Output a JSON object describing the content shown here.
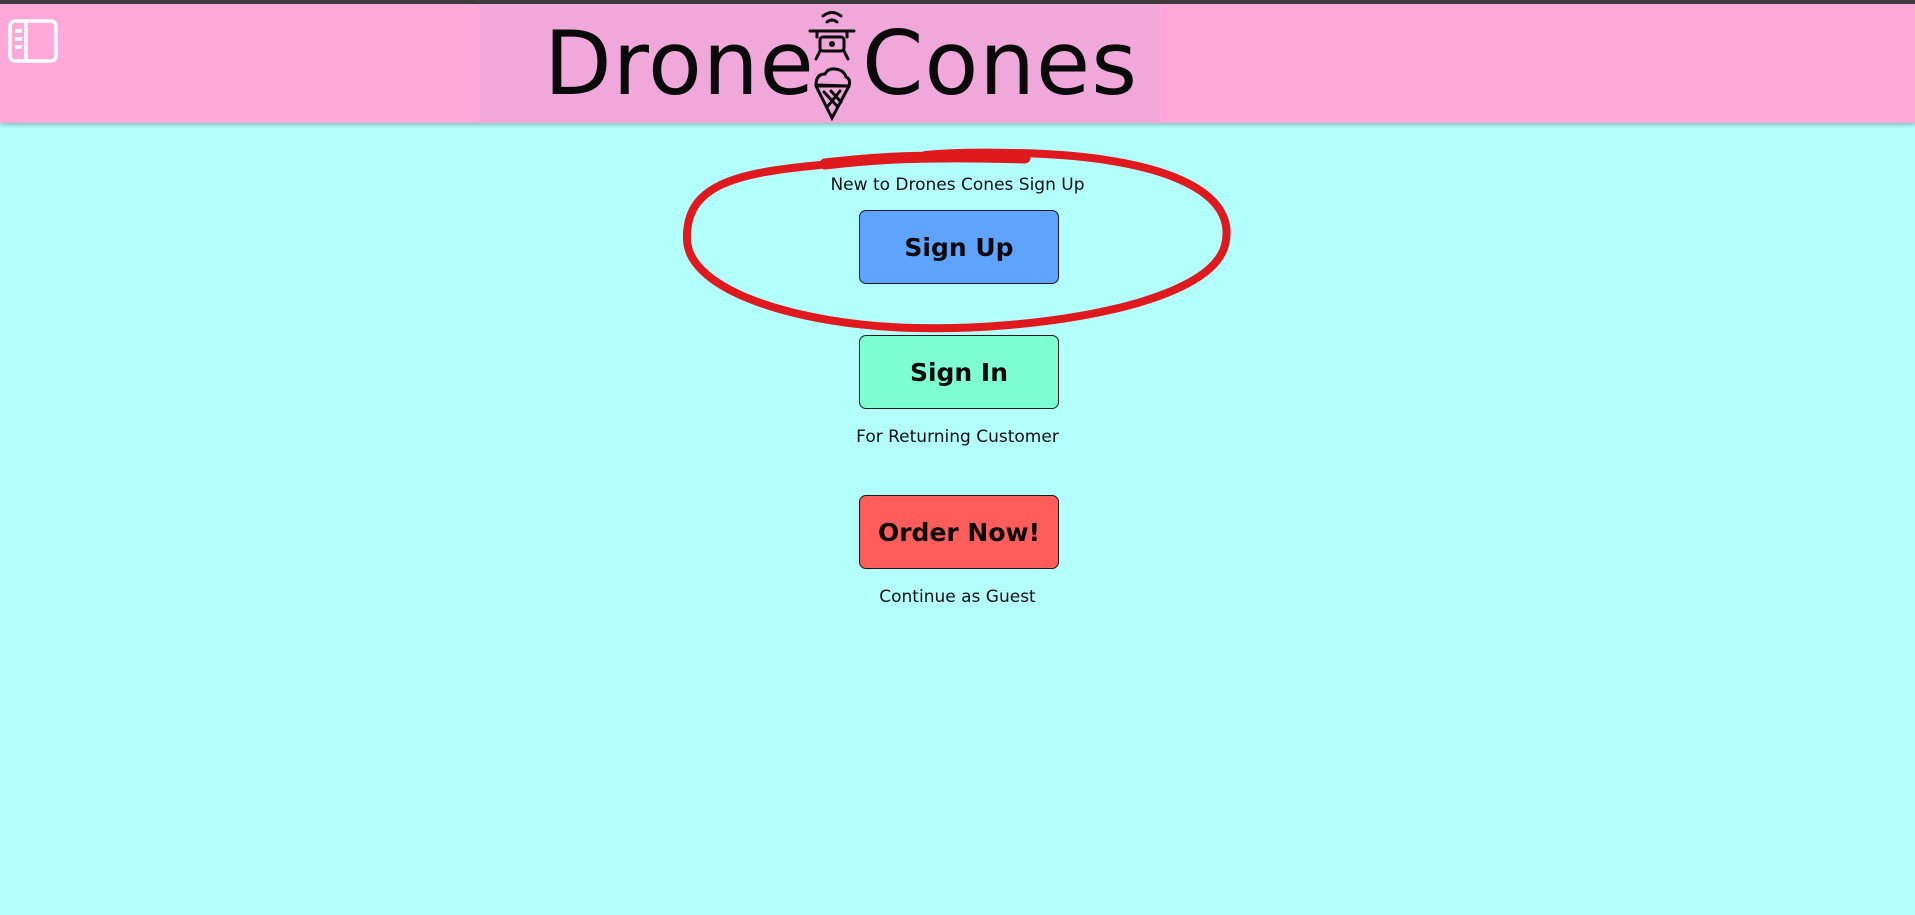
{
  "header": {
    "logo": {
      "word_left": "Drone",
      "word_right": "Cones",
      "mark_icon": "drone-ice-cream-icon"
    },
    "sidebar_toggle_icon": "sidebar-panel-icon"
  },
  "main": {
    "signup_caption": "New to Drones Cones Sign Up",
    "signup_label": "Sign Up",
    "signin_label": "Sign In",
    "signin_caption": "For Returning Customer",
    "order_label": "Order Now!",
    "order_caption": "Continue as Guest"
  },
  "colors": {
    "page_background": "#b2fffd",
    "header_background": "#ffa8d9",
    "logo_panel": "#f0a7da",
    "signup_button": "#5ea3ff",
    "signin_button": "#7dffd3",
    "order_button": "#ff5c5c",
    "annotation_ring": "#e0191f"
  }
}
